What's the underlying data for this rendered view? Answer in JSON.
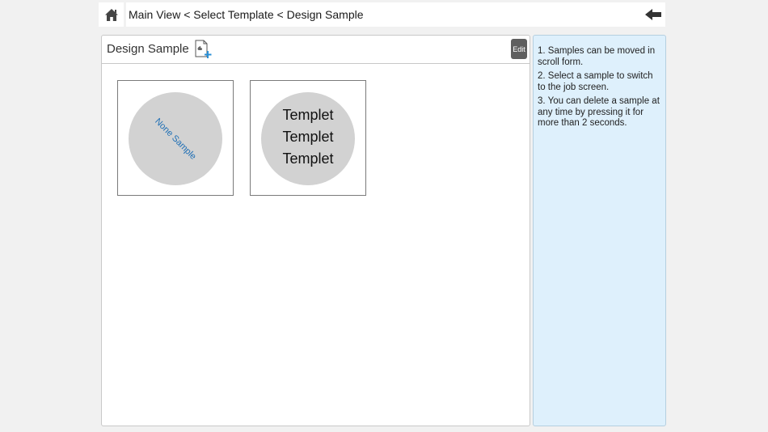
{
  "topbar": {
    "home_icon": "home-icon",
    "breadcrumb": "Main View < Select Template < Design Sample",
    "back_icon": "back-arrow-icon"
  },
  "panel": {
    "title": "Design Sample",
    "add_icon": "add-document-icon",
    "edit_label": "Edit"
  },
  "samples": [
    {
      "label": "None Sample"
    },
    {
      "lines": [
        "Templet",
        "Templet",
        "Templet"
      ]
    }
  ],
  "help": {
    "items": [
      "1. Samples can be moved in scroll form.",
      "2. Select a sample to switch to the job screen.",
      "3. You can delete a sample at any time by pressing it for more than 2 seconds."
    ]
  },
  "colors": {
    "help_bg": "#def0fc",
    "accent_text": "#1f6fb5",
    "edit_bg": "#5f5f5f"
  }
}
